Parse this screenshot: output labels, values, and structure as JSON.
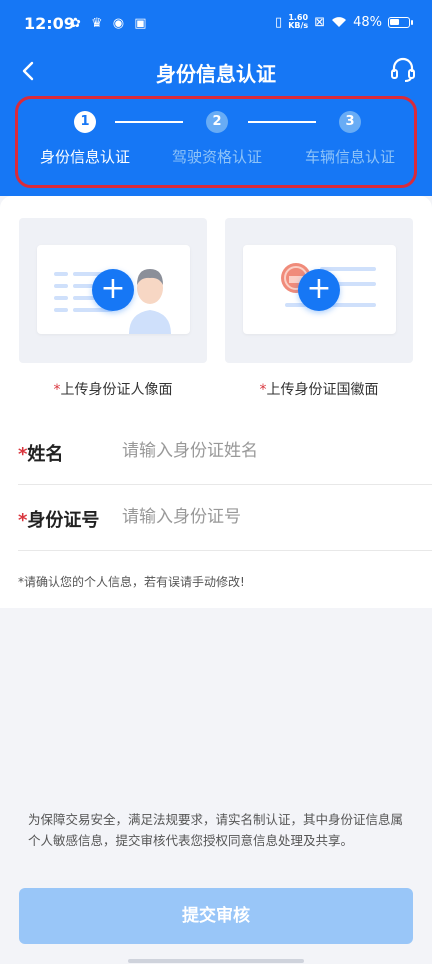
{
  "status_bar": {
    "time": "12:09",
    "net_speed_value": "1.60",
    "net_speed_unit": "KB/s",
    "battery": "48%"
  },
  "nav": {
    "title": "身份信息认证",
    "back_icon": "chevron-left-icon",
    "service_icon": "headset-icon"
  },
  "steps": [
    {
      "number": "1",
      "label": "身份信息认证",
      "state": "active"
    },
    {
      "number": "2",
      "label": "驾驶资格认证",
      "state": "inactive"
    },
    {
      "number": "3",
      "label": "车辆信息认证",
      "state": "inactive"
    }
  ],
  "uploads": {
    "front": {
      "required_mark": "*",
      "caption": "上传身份证人像面"
    },
    "back": {
      "required_mark": "*",
      "caption": "上传身份证国徽面"
    }
  },
  "form": {
    "name": {
      "required_mark": "*",
      "label": "姓名",
      "value": "",
      "placeholder": "请输入身份证姓名"
    },
    "id_number": {
      "required_mark": "*",
      "label": "身份证号",
      "value": "",
      "placeholder": "请输入身份证号"
    },
    "hint": "*请确认您的个人信息，若有误请手动修改!"
  },
  "notice": "为保障交易安全，满足法规要求，请实名制认证，其中身份证信息属个人敏感信息，提交审核代表您授权同意信息处理及共享。",
  "submit_label": "提交审核",
  "colors": {
    "primary": "#1677f5",
    "highlight_border": "#d92b3a",
    "required": "#d9363e",
    "submit_disabled": "#99c6f8"
  }
}
